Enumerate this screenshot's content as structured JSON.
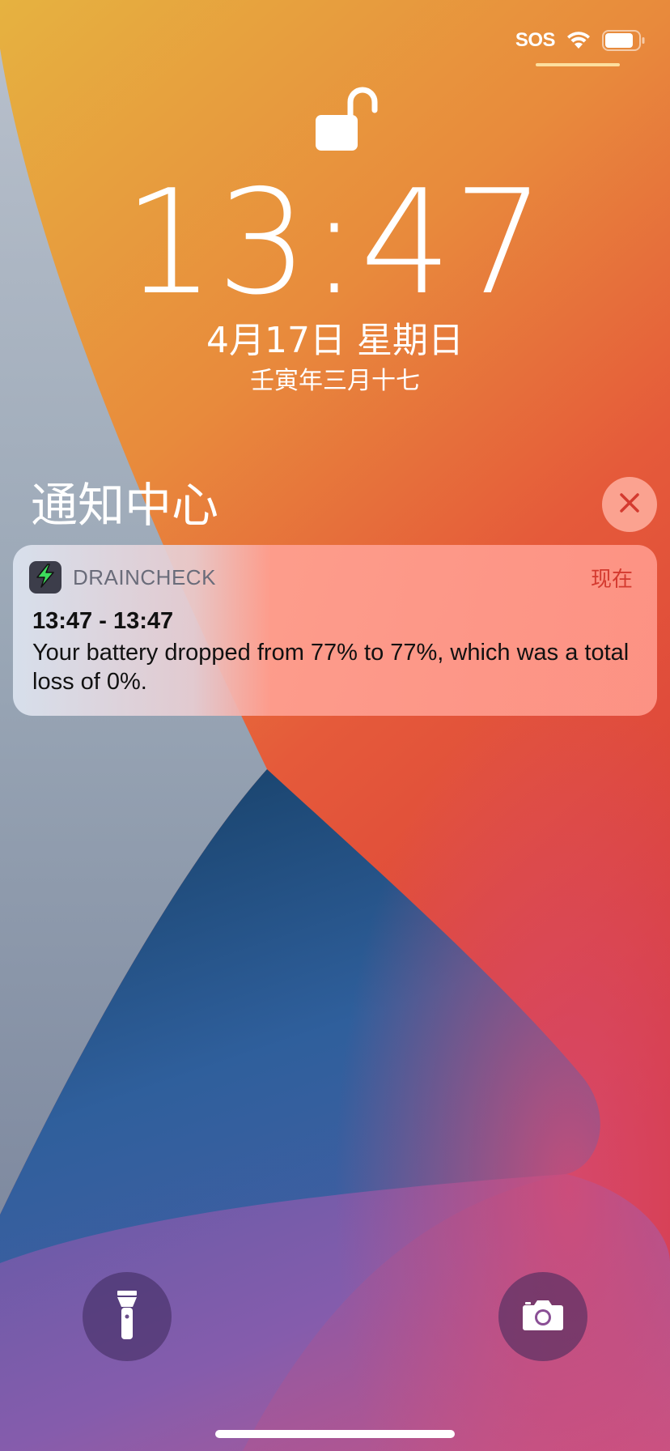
{
  "status_bar": {
    "carrier": "SOS",
    "icons": [
      "wifi-icon",
      "battery-icon"
    ]
  },
  "lock_screen": {
    "lock_icon": "unlocked-padlock-icon",
    "time": "13:47",
    "date": "4月17日 星期日",
    "lunar_date": "壬寅年三月十七"
  },
  "notification_center": {
    "title": "通知中心",
    "clear_icon": "close-icon"
  },
  "notification": {
    "app_name": "DRAINCHECK",
    "app_icon": "lightning-bolt-icon",
    "time": "现在",
    "title": "13:47 - 13:47",
    "body": "Your battery dropped from 77% to 77%, which was a total loss of 0%."
  },
  "quick_actions": {
    "left_icon": "flashlight-icon",
    "right_icon": "camera-icon"
  },
  "colors": {
    "notification_time": "#d43a2f",
    "app_name": "#6a6c7a",
    "app_icon_bg": "#3c3d4a",
    "bolt": "#3ddc5c"
  }
}
